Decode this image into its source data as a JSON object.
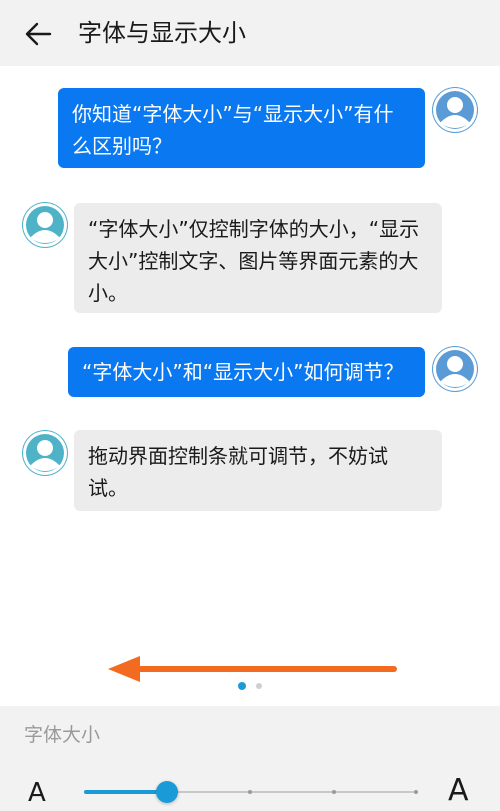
{
  "header": {
    "back_icon": "arrow-left-icon",
    "title": "字体与显示大小"
  },
  "preview": {
    "messages": [
      {
        "side": "sent",
        "text": "你知道“字体大小”与“显示大小”有什么区别吗？"
      },
      {
        "side": "received",
        "text": "“字体大小”仅控制字体的大小，“显示大小”控制文字、图片等界面元素的大小。"
      },
      {
        "side": "sent",
        "text": "“字体大小”和“显示大小”如何调节？"
      },
      {
        "side": "received",
        "text": "拖动界面控制条就可调节，不妨试试。"
      }
    ],
    "swipe_hint_icon": "arrow-left-icon",
    "swipe_hint_color": "#f26b21",
    "pager": {
      "pages": 2,
      "current": 1
    }
  },
  "font_size": {
    "label": "字体大小",
    "small_glyph": "A",
    "large_glyph": "A",
    "slider": {
      "steps": 5,
      "current_step": 2,
      "accent_color": "#1a9bd7"
    }
  },
  "colors": {
    "sent_bubble": "#0a78f0",
    "received_bubble": "#ececec",
    "accent": "#1a9bd7"
  }
}
